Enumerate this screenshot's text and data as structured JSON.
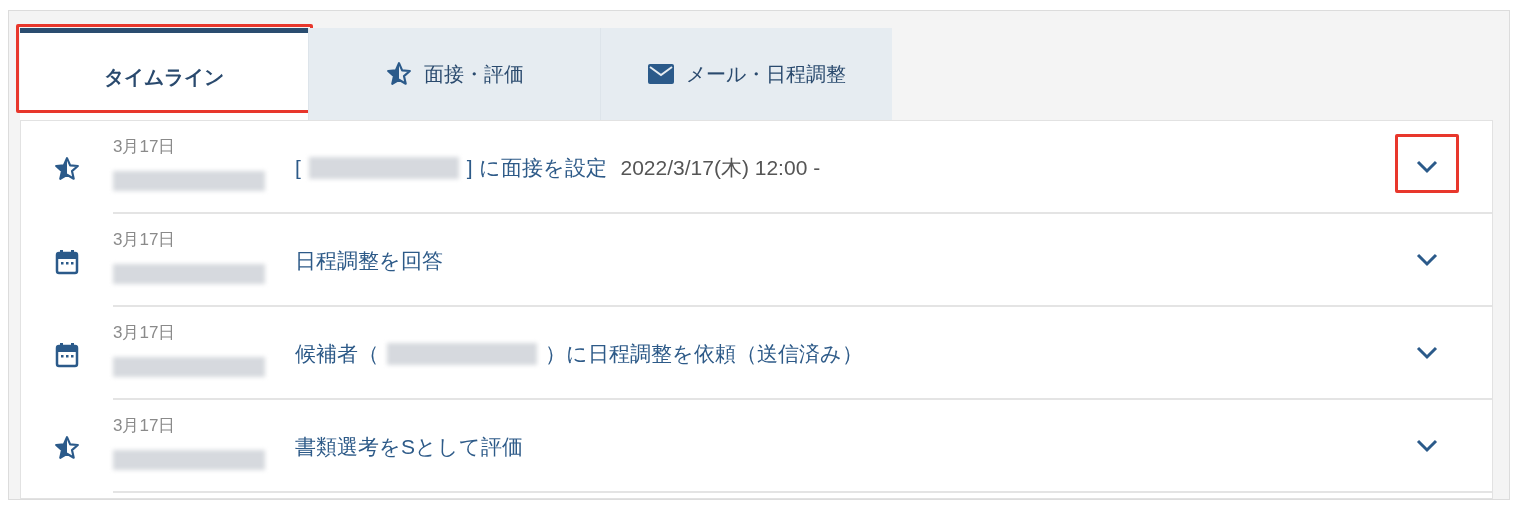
{
  "tabs": [
    {
      "label": "タイムライン",
      "kind": "plain",
      "selected": true,
      "highlighted": true
    },
    {
      "label": "面接・評価",
      "kind": "star",
      "selected": false,
      "highlighted": false
    },
    {
      "label": "メール・日程調整",
      "kind": "mail",
      "selected": false,
      "highlighted": false
    }
  ],
  "timeline": [
    {
      "kind": "star",
      "date": "3月17日",
      "segments": [
        {
          "kind": "text",
          "text": "["
        },
        {
          "kind": "redacted"
        },
        {
          "kind": "text",
          "text": "] に面接を設定"
        }
      ],
      "time": "2022/3/17(木) 12:00 -",
      "toggle_highlighted": true
    },
    {
      "kind": "calendar",
      "date": "3月17日",
      "segments": [
        {
          "kind": "text",
          "text": "日程調整を回答"
        }
      ],
      "toggle_highlighted": false
    },
    {
      "kind": "calendar",
      "date": "3月17日",
      "segments": [
        {
          "kind": "text",
          "text": "候補者（"
        },
        {
          "kind": "redacted"
        },
        {
          "kind": "text",
          "text": "）に日程調整を依頼（送信済み）"
        }
      ],
      "toggle_highlighted": false
    },
    {
      "kind": "star",
      "date": "3月17日",
      "segments": [
        {
          "kind": "text",
          "text": "書類選考をSとして評価"
        }
      ],
      "toggle_highlighted": false
    }
  ]
}
